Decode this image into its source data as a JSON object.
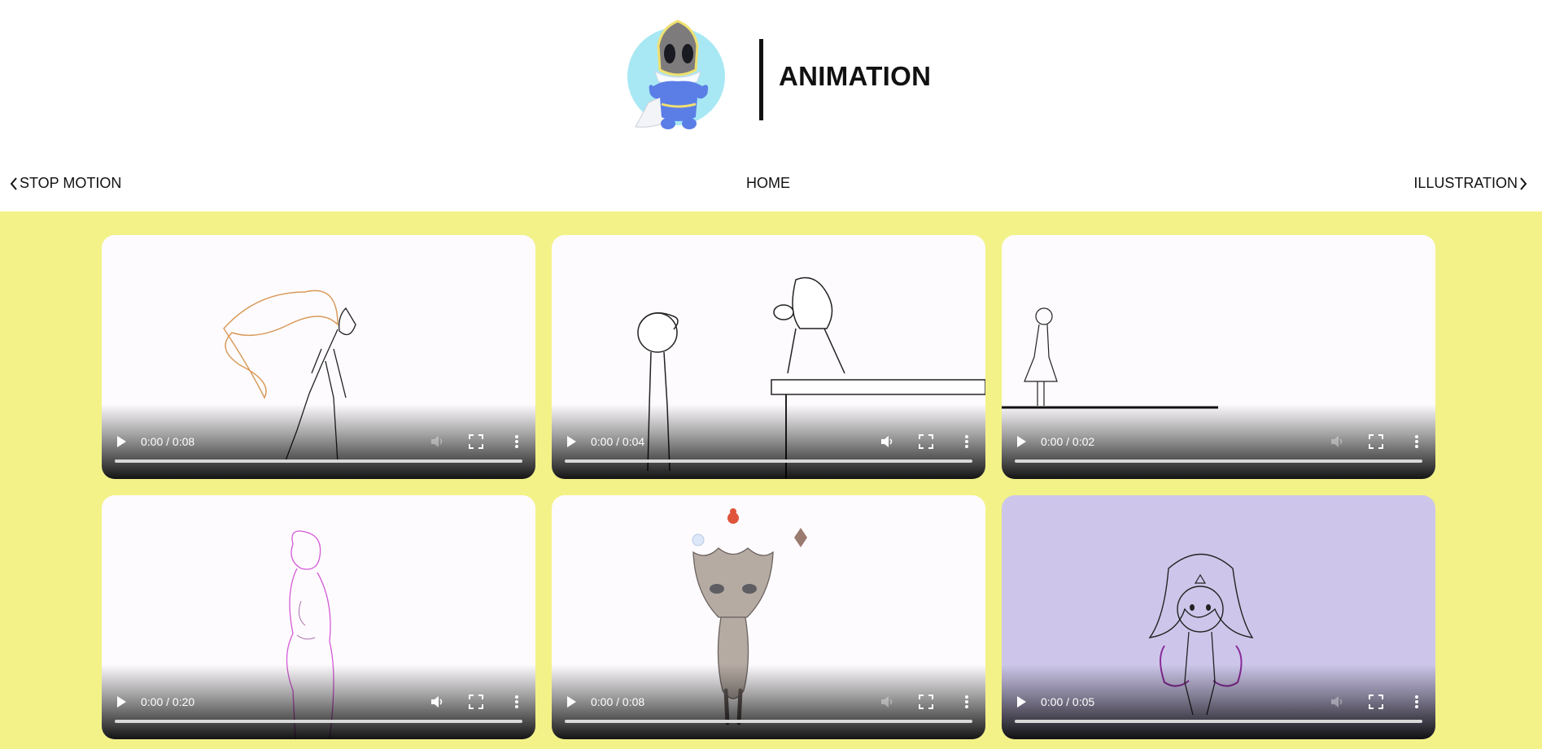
{
  "header": {
    "title": "ANIMATION"
  },
  "nav": {
    "prev_label": "STOP MOTION",
    "home_label": "HOME",
    "next_label": "ILLUSTRATION"
  },
  "videos": [
    {
      "time": "0:00 / 0:08",
      "volume_state": "muted"
    },
    {
      "time": "0:00 / 0:04",
      "volume_state": "on"
    },
    {
      "time": "0:00 / 0:02",
      "volume_state": "muted"
    },
    {
      "time": "0:00 / 0:20",
      "volume_state": "on"
    },
    {
      "time": "0:00 / 0:08",
      "volume_state": "muted"
    },
    {
      "time": "0:00 / 0:05",
      "volume_state": "muted"
    }
  ],
  "icons": {
    "logo": "mascot-icon",
    "prev": "chevron-left-icon",
    "next": "chevron-right-icon",
    "play": "play-icon",
    "volume": "volume-icon",
    "fullscreen": "fullscreen-icon",
    "more": "more-options-icon"
  },
  "colors": {
    "gallery_background": "#f3f288",
    "purple_frame": "#cdc6ea",
    "accent_blue": "#5b7ee6",
    "logo_circle": "#a8e8f4"
  }
}
